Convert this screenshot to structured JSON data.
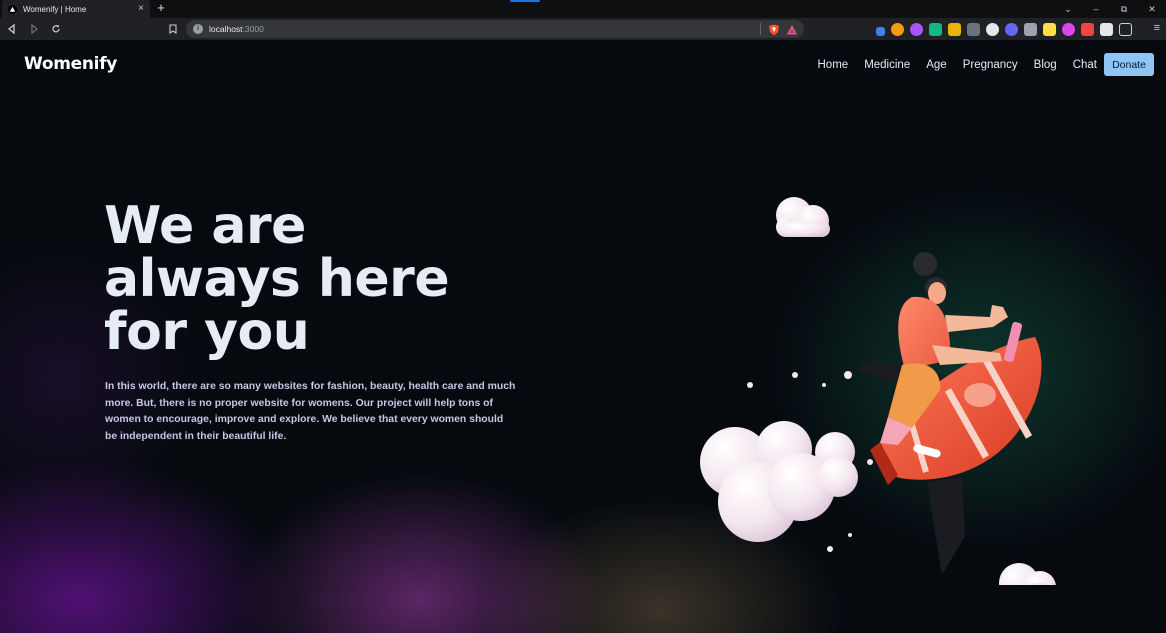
{
  "browser": {
    "tab_title": "Womenify | Home",
    "tab_close": "×",
    "new_tab": "+",
    "url_host": "localhost",
    "url_port": ":3000",
    "window_controls": {
      "collapse": "⌄",
      "minimize": "–",
      "restore": "⧉",
      "close": "✕"
    },
    "menu": "≡",
    "extensions": [
      "#3b82f6",
      "#f59e0b",
      "#a855f7",
      "#10b981",
      "#eab308",
      "#9ca3af",
      "#e5e7eb",
      "#6366f1",
      "#9ca3af",
      "#fde047",
      "#d946ef",
      "#ef4444",
      "#e5e7eb",
      "#cbd5e1"
    ]
  },
  "header": {
    "brand": "Womenify",
    "nav": [
      "Home",
      "Medicine",
      "Age",
      "Pregnancy",
      "Blog",
      "Chat"
    ],
    "donate": "Donate"
  },
  "hero": {
    "title_lines": [
      "We are",
      "always here",
      "for you"
    ],
    "description": "In this world, there are so many websites for fashion, beauty, health care and much more. But, there is no proper website for womens. Our project will help tons of women to encourage, improve and explore. We believe that every women should be independent in their beautiful life."
  },
  "colors": {
    "background": "#060a0f",
    "title": "#e6ecf5",
    "body_text": "#c3c8e4",
    "donate_button": "#8ec5f2",
    "rocket": "#f0553a"
  }
}
